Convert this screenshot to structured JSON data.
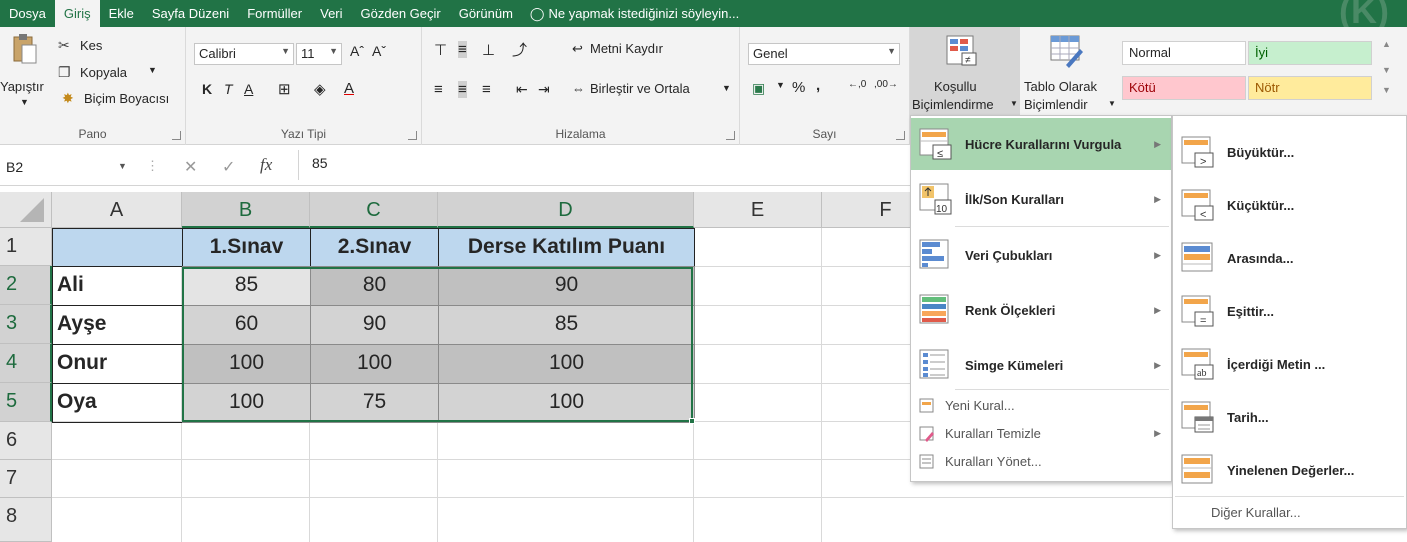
{
  "menubar": {
    "tabs": [
      "Dosya",
      "Giriş",
      "Ekle",
      "Sayfa Düzeni",
      "Formüller",
      "Veri",
      "Gözden Geçir",
      "Görünüm"
    ],
    "active_tab": "Giriş",
    "tell_me": "Ne yapmak istediğinizi söyleyin..."
  },
  "ribbon": {
    "pano": {
      "title": "Pano",
      "paste": "Yapıştır",
      "cut": "Kes",
      "copy": "Kopyala",
      "format_painter": "Biçim Boyacısı"
    },
    "font": {
      "title": "Yazı Tipi",
      "font_name": "Calibri",
      "font_size": "11",
      "bold": "K",
      "italic": "T",
      "underline": "A"
    },
    "alignment": {
      "title": "Hizalama",
      "wrap": "Metni Kaydır",
      "merge": "Birleştir ve Ortala"
    },
    "number": {
      "title": "Sayı",
      "format": "Genel",
      "percent": "%",
      "comma": ",",
      "inc_dec": ",0\n,00",
      "dec_dec": ",00\n→,0"
    },
    "styles": {
      "conditional_line1": "Koşullu",
      "conditional_line2": "Biçimlendirme",
      "table_line1": "Tablo Olarak",
      "table_line2": "Biçimlendir",
      "normal": "Normal",
      "good": "İyi",
      "bad": "Kötü",
      "neutral": "Nötr"
    }
  },
  "formula_bar": {
    "name_box": "B2",
    "fx": "fx",
    "value": "85"
  },
  "grid": {
    "columns": [
      "A",
      "B",
      "C",
      "D",
      "E",
      "F"
    ],
    "rows": [
      "1",
      "2",
      "3",
      "4",
      "5",
      "6",
      "7",
      "8"
    ],
    "header_row": [
      "",
      "1.Sınav",
      "2.Sınav",
      "Derse Katılım Puanı"
    ],
    "data": [
      [
        "Ali",
        "85",
        "80",
        "90"
      ],
      [
        "Ayşe",
        "60",
        "90",
        "85"
      ],
      [
        "Onur",
        "100",
        "100",
        "100"
      ],
      [
        "Oya",
        "100",
        "75",
        "100"
      ]
    ]
  },
  "cf_menu": {
    "items": [
      "Hücre Kurallarını Vurgula",
      "İlk/Son Kuralları",
      "Veri Çubukları",
      "Renk Ölçekleri",
      "Simge Kümeleri"
    ],
    "small_items": [
      "Yeni Kural...",
      "Kuralları Temizle",
      "Kuralları Yönet..."
    ]
  },
  "sub_menu": {
    "items": [
      "Büyüktür...",
      "Küçüktür...",
      "Arasında...",
      "Eşittir...",
      "İçerdiği Metin ...",
      "Tarih...",
      "Yinelenen Değerler..."
    ],
    "more": "Diğer Kurallar..."
  },
  "colors": {
    "excel_green": "#217346",
    "header_fill": "#bdd7ee",
    "highlight": "#a8d5b0"
  }
}
